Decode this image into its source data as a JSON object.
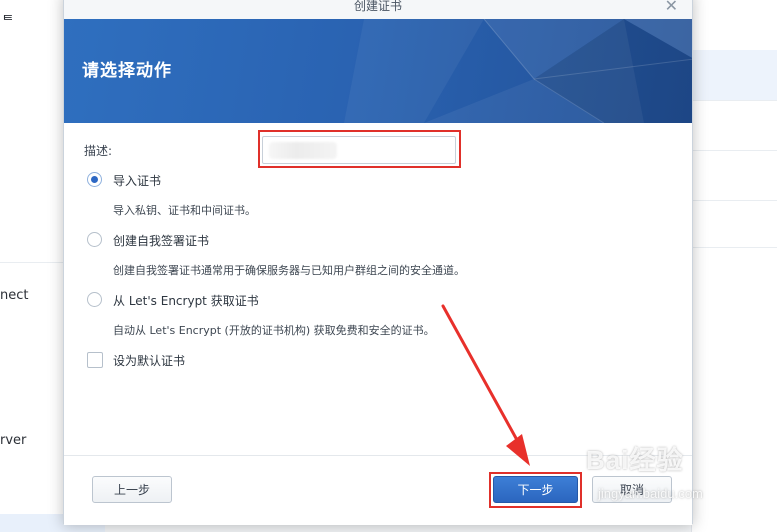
{
  "background": {
    "left_fragments": [
      "ᄐ",
      "nect",
      "rver"
    ],
    "colors": {
      "selected_row": "#e8f0fb"
    }
  },
  "dialog": {
    "title": "创建证书",
    "close_glyph": "✕",
    "banner": {
      "heading": "请选择动作",
      "colors": {
        "from": "#2f6fbf",
        "to": "#214f95"
      }
    },
    "description": {
      "label": "描述:",
      "value": ""
    },
    "options": [
      {
        "label": "导入证书",
        "desc": "导入私钥、证书和中间证书。",
        "checked": true
      },
      {
        "label": "创建自我签署证书",
        "desc": "创建自我签署证书通常用于确保服务器与已知用户群组之间的安全通道。",
        "checked": false
      },
      {
        "label": "从 Let's Encrypt 获取证书",
        "desc": "自动从 Let's Encrypt (开放的证书机构) 获取免费和安全的证书。",
        "checked": false
      }
    ],
    "default_cert": {
      "label": "设为默认证书",
      "checked": false
    },
    "buttons": {
      "prev": "上一步",
      "next": "下一步",
      "cancel": "取消"
    }
  },
  "annotations": {
    "highlight_color": "#e0302a",
    "arrow_color": "#e8302b"
  },
  "watermark": {
    "text": "Bai经验",
    "url": "jingyan.baidu.com"
  }
}
